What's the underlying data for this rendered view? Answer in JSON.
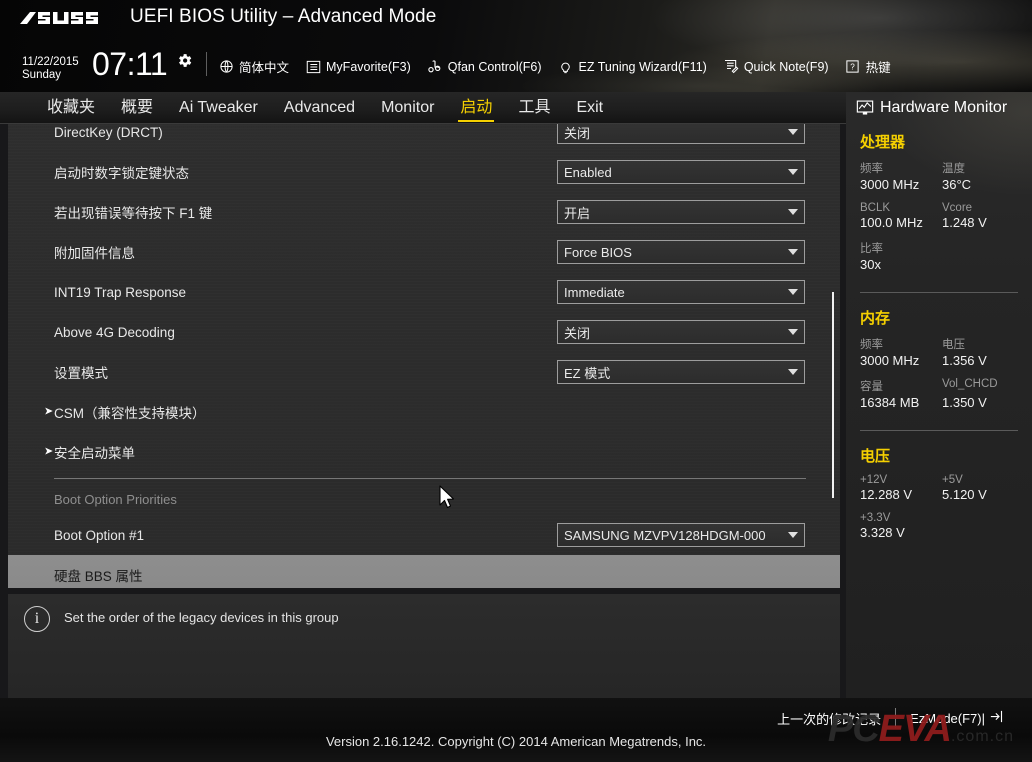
{
  "header": {
    "logo": "asus-logo",
    "title": "UEFI BIOS Utility – Advanced Mode",
    "date": "11/22/2015",
    "weekday": "Sunday",
    "time": "07:11",
    "gear_icon": "gear-icon",
    "tools": [
      {
        "icon": "globe-icon",
        "label": "简体中文"
      },
      {
        "icon": "list-icon",
        "label": "MyFavorite(F3)"
      },
      {
        "icon": "fan-icon",
        "label": "Qfan Control(F6)"
      },
      {
        "icon": "bulb-icon",
        "label": "EZ Tuning Wizard(F11)"
      },
      {
        "icon": "note-icon",
        "label": "Quick Note(F9)"
      },
      {
        "icon": "question-icon",
        "label": "热键"
      }
    ]
  },
  "nav": {
    "tabs": [
      {
        "label": "收藏夹",
        "active": false
      },
      {
        "label": "概要",
        "active": false
      },
      {
        "label": "Ai Tweaker",
        "active": false
      },
      {
        "label": "Advanced",
        "active": false
      },
      {
        "label": "Monitor",
        "active": false
      },
      {
        "label": "启动",
        "active": true
      },
      {
        "label": "工具",
        "active": false
      },
      {
        "label": "Exit",
        "active": false
      }
    ],
    "active_color": "#f5d000"
  },
  "main": {
    "rows": [
      {
        "label": "DirectKey (DRCT)",
        "value": "关闭",
        "kind": "dropdown",
        "partial": true
      },
      {
        "label": "启动时数字锁定键状态",
        "value": "Enabled",
        "kind": "dropdown"
      },
      {
        "label": "若出现错误等待按下 F1 键",
        "value": "开启",
        "kind": "dropdown"
      },
      {
        "label": "附加固件信息",
        "value": "Force BIOS",
        "kind": "dropdown"
      },
      {
        "label": "INT19 Trap Response",
        "value": "Immediate",
        "kind": "dropdown"
      },
      {
        "label": "Above 4G Decoding",
        "value": "关闭",
        "kind": "dropdown"
      },
      {
        "label": "设置模式",
        "value": "EZ 模式",
        "kind": "dropdown"
      },
      {
        "label": "CSM（兼容性支持模块）",
        "value": "",
        "kind": "submenu"
      },
      {
        "label": "安全启动菜单",
        "value": "",
        "kind": "submenu"
      }
    ],
    "section_heading": "Boot Option Priorities",
    "boot_option": {
      "label": "Boot Option #1",
      "value": "SAMSUNG MZVPV128HDGM-000"
    },
    "selected_row": {
      "label": "硬盘 BBS 属性"
    },
    "arrow_icon": "chevron-right-icon"
  },
  "hwmon": {
    "icon": "monitor-icon",
    "title": "Hardware Monitor",
    "sections": [
      {
        "heading": "处理器",
        "pairs": [
          {
            "k1": "频率",
            "v1": "3000 MHz",
            "k2": "温度",
            "v2": "36°C"
          },
          {
            "k1": "BCLK",
            "v1": "100.0 MHz",
            "k2": "Vcore",
            "v2": "1.248 V"
          },
          {
            "k1": "比率",
            "v1": "30x",
            "k2": "",
            "v2": ""
          }
        ]
      },
      {
        "heading": "内存",
        "pairs": [
          {
            "k1": "频率",
            "v1": "3000 MHz",
            "k2": "电压",
            "v2": "1.356 V"
          },
          {
            "k1": "容量",
            "v1": "16384 MB",
            "k2": "Vol_CHCD",
            "v2": "1.350 V"
          }
        ]
      },
      {
        "heading": "电压",
        "pairs": [
          {
            "k1": "+12V",
            "v1": "12.288 V",
            "k2": "+5V",
            "v2": "5.120 V"
          },
          {
            "k1": "+3.3V",
            "v1": "3.328 V",
            "k2": "",
            "v2": ""
          }
        ]
      }
    ]
  },
  "info": {
    "icon": "info-icon",
    "text": "Set the order of the legacy devices in this group"
  },
  "footer": {
    "last_modified": "上一次的修改记录",
    "ez_mode": "EzMode(F7)|",
    "ez_mode_icon": "arrow-right-box-icon",
    "version": "Version 2.16.1242. Copyright (C) 2014 American Megatrends, Inc.",
    "watermark": {
      "p": "PC",
      "e": "E",
      "v": "V",
      "a": "A",
      "domain": ".com.cn"
    }
  }
}
